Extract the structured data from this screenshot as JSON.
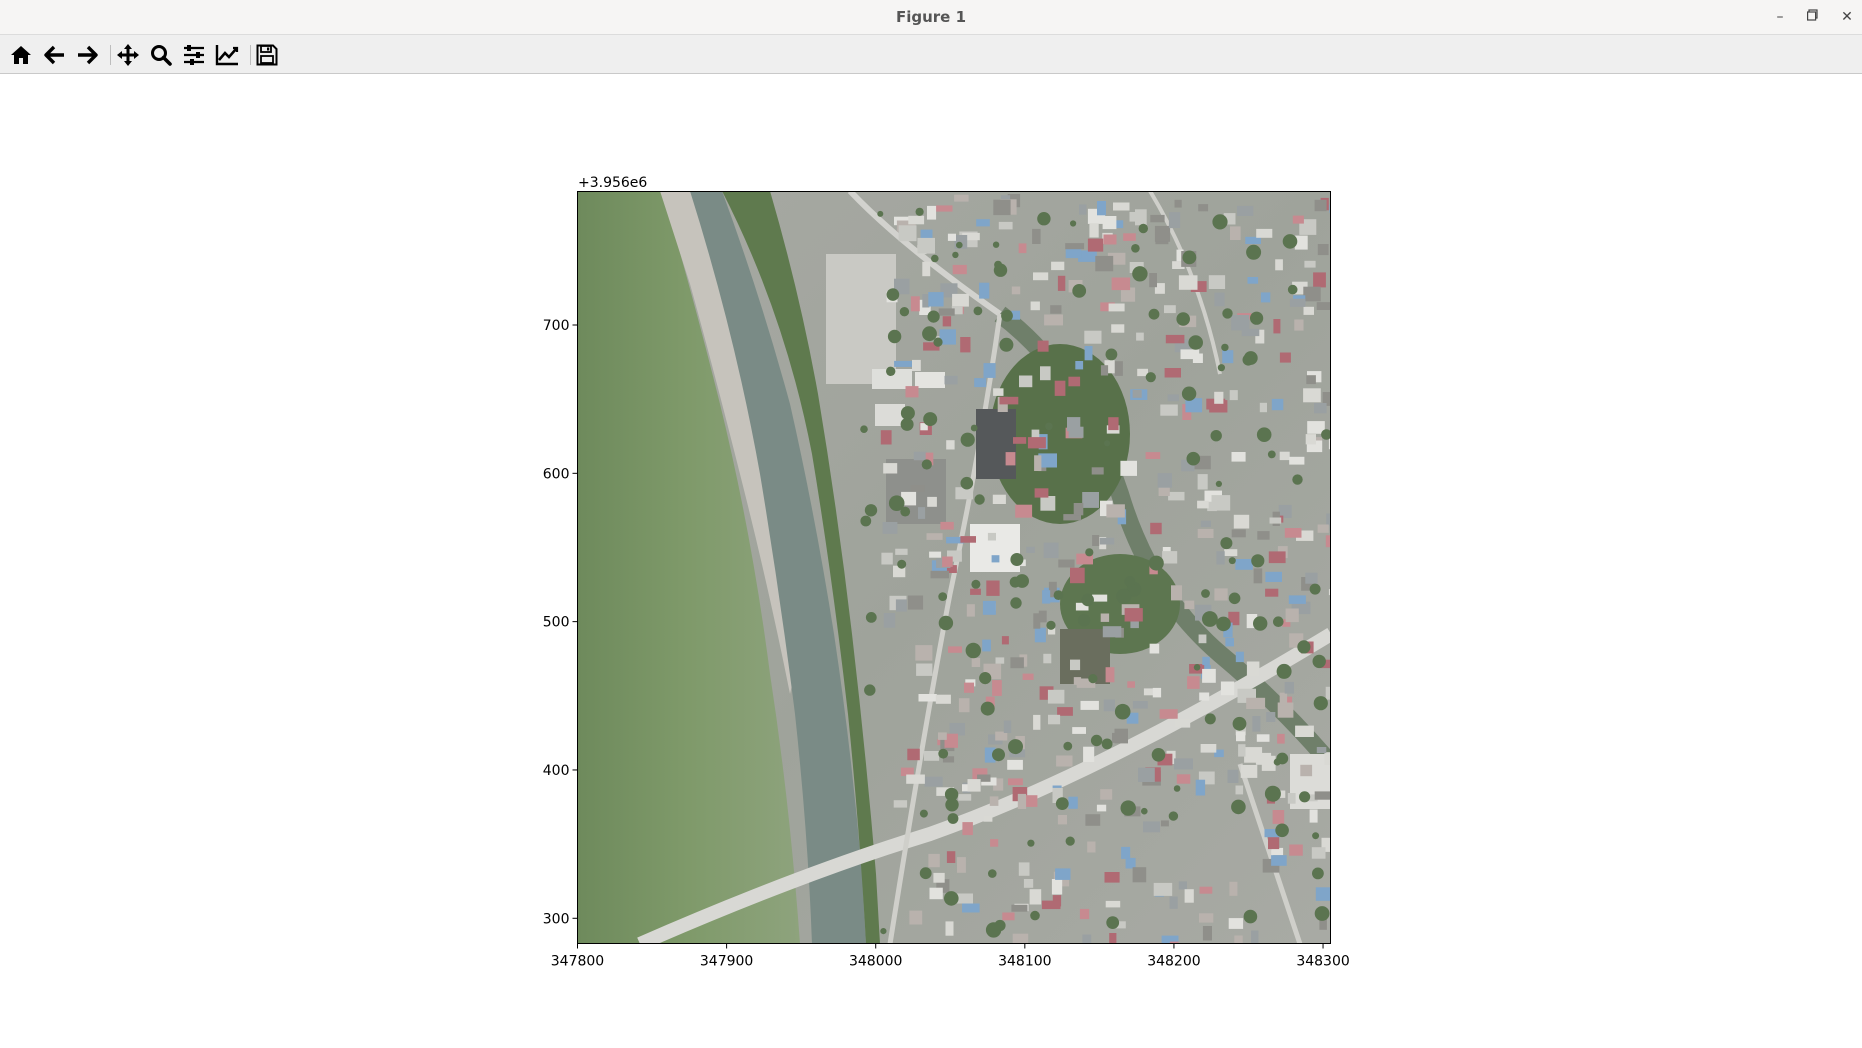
{
  "window": {
    "title": "Figure 1"
  },
  "toolbar": {
    "buttons": [
      {
        "icon": "home-icon"
      },
      {
        "icon": "back-arrow-icon"
      },
      {
        "icon": "forward-arrow-icon"
      },
      {
        "icon": "pan-move-icon"
      },
      {
        "icon": "zoom-magnifier-icon"
      },
      {
        "icon": "configure-subplots-icon"
      },
      {
        "icon": "edit-axis-line-icon"
      },
      {
        "icon": "save-floppy-icon"
      }
    ]
  },
  "chart_data": {
    "type": "image",
    "content": "aerial orthophoto",
    "offset_text": "+3.956e6",
    "xlim": [
      347800,
      348305
    ],
    "ylim": [
      283,
      790
    ],
    "x_ticks": [
      347800,
      347900,
      348000,
      348100,
      348200,
      348300
    ],
    "x_tick_labels": [
      "347800",
      "347900",
      "348000",
      "348100",
      "348200",
      "348300"
    ],
    "y_ticks": [
      300,
      400,
      500,
      600,
      700
    ],
    "y_tick_labels": [
      "300",
      "400",
      "500",
      "600",
      "700"
    ],
    "grid": false
  }
}
